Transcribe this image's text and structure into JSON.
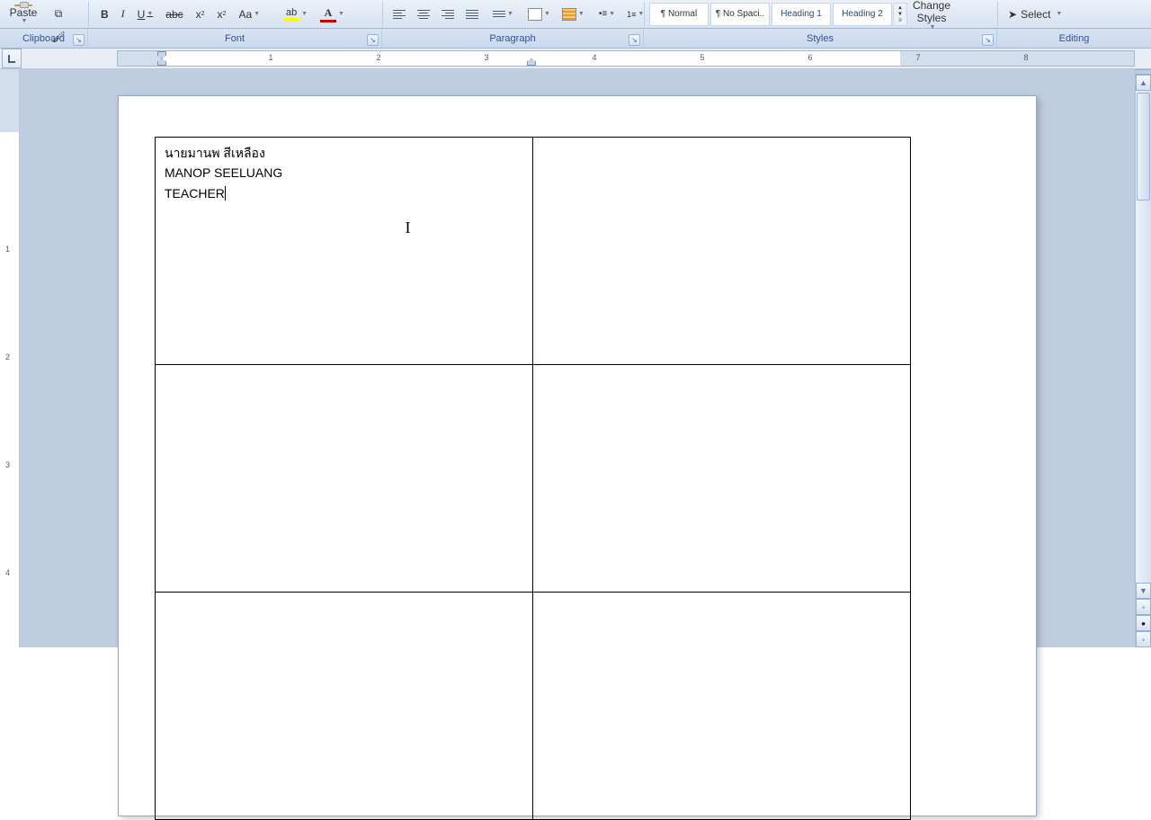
{
  "ribbon": {
    "paste": "Paste",
    "font": {
      "bold": "B",
      "italic": "I",
      "underline": "U",
      "strike": "abc",
      "sub": "x",
      "sup": "x",
      "case": "Aa"
    },
    "styles": {
      "items": [
        "¶ Normal",
        "¶ No Spaci..",
        "Heading 1",
        "Heading 2"
      ],
      "change": "Change Styles"
    },
    "editing": {
      "select": "Select"
    }
  },
  "groups": {
    "clipboard": "Clipboard",
    "font": "Font",
    "paragraph": "Paragraph",
    "styles": "Styles",
    "editing": "Editing"
  },
  "ruler": {
    "numbers": [
      "1",
      "2",
      "3",
      "4",
      "5",
      "6",
      "7",
      "8"
    ]
  },
  "vruler": {
    "numbers": [
      "1",
      "2",
      "3",
      "4"
    ]
  },
  "document": {
    "cell1": {
      "line1": "นายมานพ สีเหลือง",
      "line2": "MANOP SEELUANG",
      "line3": "TEACHER"
    }
  }
}
